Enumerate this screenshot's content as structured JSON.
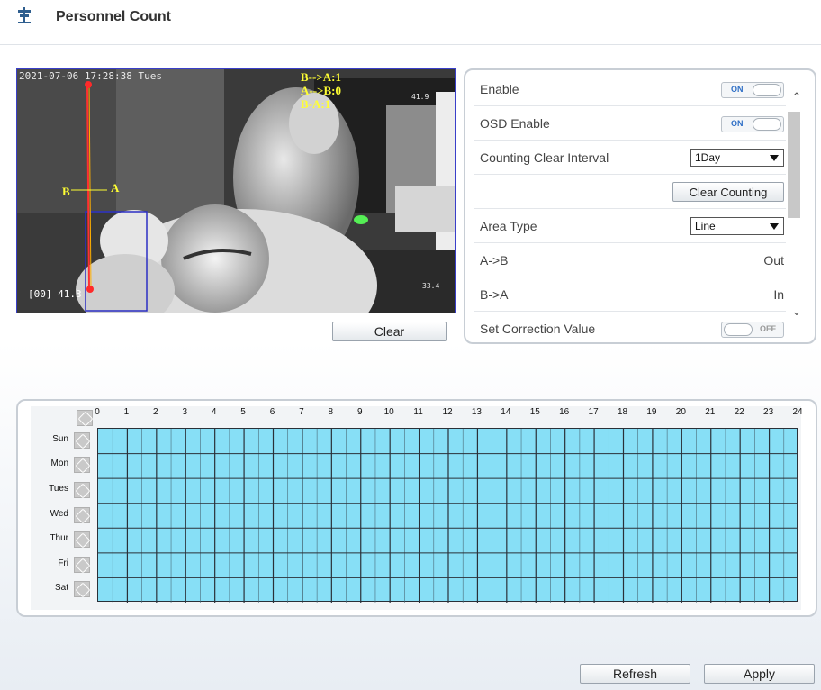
{
  "header": {
    "title": "Personnel Count",
    "icon": "person-count-icon"
  },
  "video": {
    "timestamp": "2021-07-06 17:28:38 Tues",
    "count_lines": [
      "B-->A:1",
      "A-->B:0",
      "B-A:1"
    ],
    "label_b": "B",
    "label_a": "A",
    "temp_top": "41.9",
    "temp_right": "33.4",
    "bottom_left": "[00] 41.3",
    "clear_label": "Clear"
  },
  "settings": {
    "rows": [
      {
        "label": "Enable",
        "type": "toggle",
        "value": "ON"
      },
      {
        "label": "OSD Enable",
        "type": "toggle",
        "value": "ON"
      },
      {
        "label": "Counting Clear Interval",
        "type": "select",
        "value": "1Day"
      },
      {
        "label": "",
        "type": "button",
        "value": "Clear Counting"
      },
      {
        "label": "Area Type",
        "type": "select",
        "value": "Line"
      },
      {
        "label": "A->B",
        "type": "text",
        "value": "Out"
      },
      {
        "label": "B->A",
        "type": "text",
        "value": "In"
      },
      {
        "label": "Set Correction Value",
        "type": "toggle",
        "value": "OFF"
      }
    ]
  },
  "schedule": {
    "hours": [
      "0",
      "1",
      "2",
      "3",
      "4",
      "5",
      "6",
      "7",
      "8",
      "9",
      "10",
      "11",
      "12",
      "13",
      "14",
      "15",
      "16",
      "17",
      "18",
      "19",
      "20",
      "21",
      "22",
      "23",
      "24"
    ],
    "days": [
      "Sun",
      "Mon",
      "Tues",
      "Wed",
      "Thur",
      "Fri",
      "Sat"
    ],
    "fill_color": "#87dff6"
  },
  "footer": {
    "refresh_label": "Refresh",
    "apply_label": "Apply"
  }
}
